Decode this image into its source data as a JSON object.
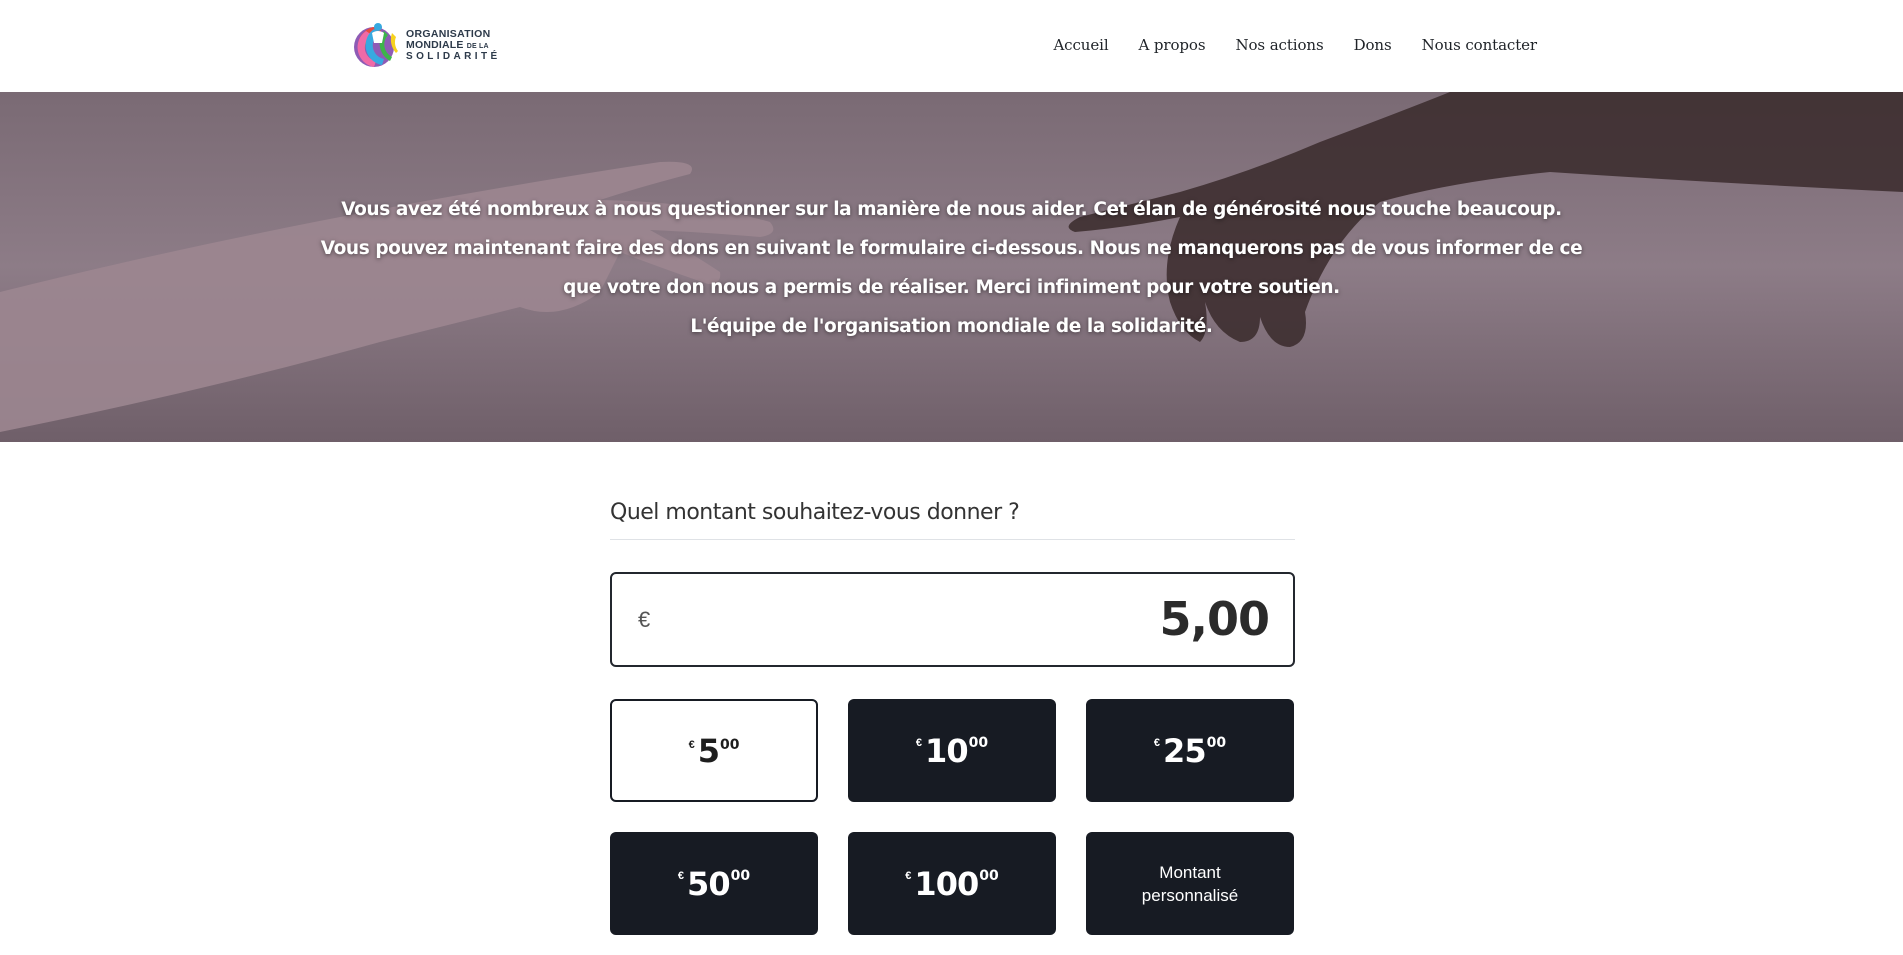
{
  "header": {
    "logo": {
      "line1": "ORGANISATION",
      "line2": "MONDIALE",
      "line2_small": "DE LA",
      "line3": "SOLIDARITÉ"
    },
    "nav": [
      {
        "label": "Accueil"
      },
      {
        "label": "A propos"
      },
      {
        "label": "Nos actions"
      },
      {
        "label": "Dons"
      },
      {
        "label": "Nous contacter"
      }
    ]
  },
  "hero": {
    "lines": [
      "Vous avez été nombreux à nous questionner sur la manière de nous aider. Cet élan de générosité nous touche beaucoup.",
      "Vous pouvez maintenant faire des dons en suivant le formulaire ci-dessous. Nous ne manquerons pas de vous informer de ce",
      "que votre don nous a permis de réaliser. Merci infiniment pour votre soutien.",
      "L'équipe de l'organisation mondiale de la solidarité."
    ]
  },
  "donation": {
    "question": "Quel montant souhaitez-vous donner ?",
    "currency_symbol": "€",
    "amount_value": "5,00",
    "options": [
      {
        "currency": "€",
        "integer": "5",
        "cents": "00",
        "selected": true
      },
      {
        "currency": "€",
        "integer": "10",
        "cents": "00",
        "selected": false
      },
      {
        "currency": "€",
        "integer": "25",
        "cents": "00",
        "selected": false
      },
      {
        "currency": "€",
        "integer": "50",
        "cents": "00",
        "selected": false
      },
      {
        "currency": "€",
        "integer": "100",
        "cents": "00",
        "selected": false
      }
    ],
    "custom_label": "Montant personnalisé"
  },
  "colors": {
    "button_dark": "#171b23",
    "text": "#2b2b2b"
  }
}
